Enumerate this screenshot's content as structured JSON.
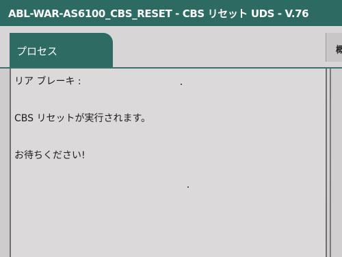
{
  "window": {
    "title": "ABL-WAR-AS6100_CBS_RESET - CBS リセット UDS - V.76"
  },
  "tabs": {
    "active_label": "プロセス",
    "right_label": "概"
  },
  "panel": {
    "line1": "リア ブレーキ :",
    "line2": "CBS リセットが実行されます。",
    "line3": "お待ちください!"
  },
  "colors": {
    "title_bar": "#2d6a62",
    "tab_active": "#2e6b63",
    "background": "#d6d3d4"
  }
}
